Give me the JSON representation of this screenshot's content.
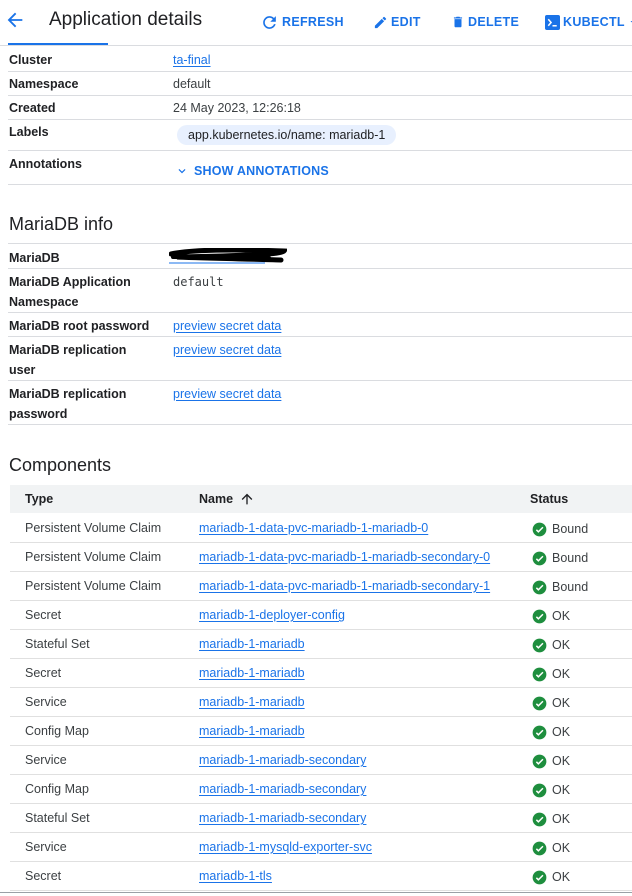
{
  "header": {
    "title": "Application details",
    "refresh_label": "REFRESH",
    "edit_label": "EDIT",
    "delete_label": "DELETE",
    "kubectl_label": "KUBECTL"
  },
  "details": {
    "cluster_label": "Cluster",
    "cluster_value": "ta-final",
    "namespace_label": "Namespace",
    "namespace_value": "default",
    "created_label": "Created",
    "created_value": "24 May 2023, 12:26:18",
    "labels_label": "Labels",
    "labels_chip": "app.kubernetes.io/name: mariadb-1",
    "annotations_label": "Annotations",
    "show_annotations": "SHOW ANNOTATIONS"
  },
  "mariadb": {
    "section_title": "MariaDB info",
    "mariadb_label": "MariaDB",
    "app_ns_label_1": "MariaDB Application",
    "app_ns_label_2": "Namespace",
    "app_ns_value": "default",
    "root_pw_label": "MariaDB root password",
    "root_pw_link": "preview secret data",
    "repl_user_label_1": "MariaDB replication",
    "repl_user_label_2": "user",
    "repl_user_link": "preview secret data",
    "repl_pw_label_1": "MariaDB replication",
    "repl_pw_label_2": "password",
    "repl_pw_link": "preview secret data"
  },
  "components": {
    "section_title": "Components",
    "columns": {
      "type": "Type",
      "name": "Name",
      "status": "Status"
    },
    "rows": [
      {
        "type": "Persistent Volume Claim",
        "name": "mariadb-1-data-pvc-mariadb-1-mariadb-0",
        "status": "Bound"
      },
      {
        "type": "Persistent Volume Claim",
        "name": "mariadb-1-data-pvc-mariadb-1-mariadb-secondary-0",
        "status": "Bound"
      },
      {
        "type": "Persistent Volume Claim",
        "name": "mariadb-1-data-pvc-mariadb-1-mariadb-secondary-1",
        "status": "Bound"
      },
      {
        "type": "Secret",
        "name": "mariadb-1-deployer-config",
        "status": "OK"
      },
      {
        "type": "Stateful Set",
        "name": "mariadb-1-mariadb",
        "status": "OK"
      },
      {
        "type": "Secret",
        "name": "mariadb-1-mariadb",
        "status": "OK"
      },
      {
        "type": "Service",
        "name": "mariadb-1-mariadb",
        "status": "OK"
      },
      {
        "type": "Config Map",
        "name": "mariadb-1-mariadb",
        "status": "OK"
      },
      {
        "type": "Service",
        "name": "mariadb-1-mariadb-secondary",
        "status": "OK"
      },
      {
        "type": "Config Map",
        "name": "mariadb-1-mariadb-secondary",
        "status": "OK"
      },
      {
        "type": "Stateful Set",
        "name": "mariadb-1-mariadb-secondary",
        "status": "OK"
      },
      {
        "type": "Service",
        "name": "mariadb-1-mysqld-exporter-svc",
        "status": "OK"
      },
      {
        "type": "Secret",
        "name": "mariadb-1-tls",
        "status": "OK"
      }
    ]
  },
  "colors": {
    "accent": "#1a73e8",
    "status_ok": "#1e8e3e",
    "chip_bg": "#e8f0fe"
  }
}
